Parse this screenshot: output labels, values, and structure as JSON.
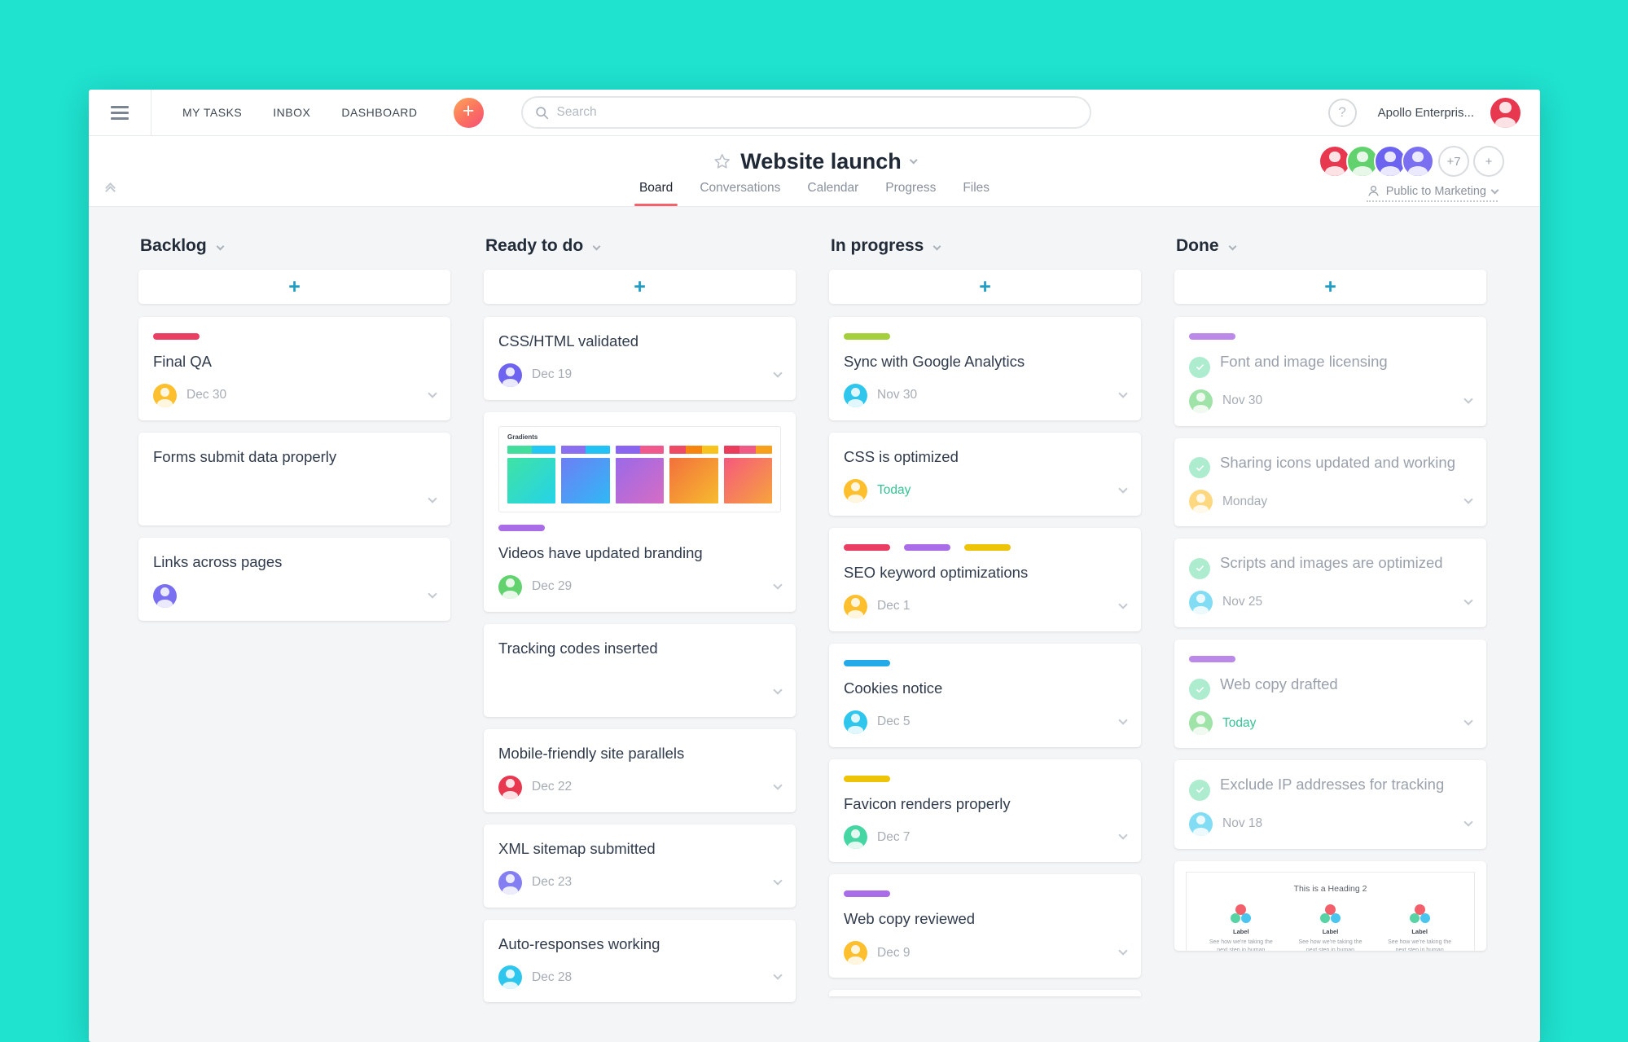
{
  "colors": {
    "page_bg": "#1fe2cf",
    "tab_underline_red": "#f5626a",
    "add_card_teal": "#1f9dc6",
    "today_green": "#36c493",
    "done_check_mint": "#aeeccf"
  },
  "nav": {
    "items": [
      "MY TASKS",
      "INBOX",
      "DASHBOARD"
    ],
    "add_button": "+",
    "search_placeholder": "Search",
    "help_label": "?",
    "workspace": "Apollo Enterpris...",
    "profile_avatar_color": "#e8384f"
  },
  "header": {
    "title": "Website launch",
    "tabs": [
      {
        "label": "Board",
        "active": true
      },
      {
        "label": "Conversations",
        "active": false
      },
      {
        "label": "Calendar",
        "active": false
      },
      {
        "label": "Progress",
        "active": false
      },
      {
        "label": "Files",
        "active": false
      }
    ],
    "member_avatars": [
      "#e8384f",
      "#62d26f",
      "#6c63f0",
      "#7a6ff0"
    ],
    "members_overflow": "+7",
    "add_member": "+",
    "privacy": "Public to Marketing"
  },
  "board": {
    "add_card_label": "+",
    "columns": [
      {
        "title": "Backlog",
        "cards": [
          {
            "title": "Final QA",
            "tags": [
              "#ea3e63"
            ],
            "avatar": "#fdbf2d",
            "due": "Dec 30"
          },
          {
            "title": "Forms submit data properly"
          },
          {
            "title": "Links across pages",
            "avatar": "#7a6ff0"
          }
        ]
      },
      {
        "title": "Ready to do",
        "cards": [
          {
            "title": "CSS/HTML validated",
            "avatar": "#6e63f0",
            "due": "Dec 19"
          },
          {
            "title": "Videos have updated branding",
            "tags": [
              "#aa6de8"
            ],
            "avatar": "#62d26f",
            "due": "Dec 29",
            "attachment": "gradients"
          },
          {
            "title": "Tracking codes inserted"
          },
          {
            "title": "Mobile-friendly site parallels",
            "avatar": "#e8384f",
            "due": "Dec 22"
          },
          {
            "title": "XML sitemap submitted",
            "avatar": "#837ff2",
            "due": "Dec 23"
          },
          {
            "title": "Auto-responses working",
            "avatar": "#2fc6ee",
            "due": "Dec 28"
          }
        ]
      },
      {
        "title": "In progress",
        "cards": [
          {
            "title": "Sync with Google Analytics",
            "tags": [
              "#a5cf3c"
            ],
            "avatar": "#2fc6ee",
            "due": "Nov 30"
          },
          {
            "title": "CSS is optimized",
            "avatar": "#fdbf2d",
            "due": "Today",
            "due_today": true
          },
          {
            "title": "SEO keyword optimizations",
            "tags": [
              "#ea3e63",
              "#aa6de8",
              "#edc407"
            ],
            "avatar": "#fdbf2d",
            "due": "Dec 1"
          },
          {
            "title": "Cookies notice",
            "tags": [
              "#25a9e8"
            ],
            "avatar": "#2fc6ee",
            "due": "Dec 5"
          },
          {
            "title": "Favicon renders properly",
            "tags": [
              "#edc407"
            ],
            "avatar": "#45d6a3",
            "due": "Dec 7"
          },
          {
            "title": "Web copy reviewed",
            "tags": [
              "#aa6de8"
            ],
            "avatar": "#fdbf2d",
            "due": "Dec 9"
          },
          {
            "sliver": true
          }
        ]
      },
      {
        "title": "Done",
        "cards": [
          {
            "title": "Font and image licensing",
            "tags": [
              "#bb8ae8"
            ],
            "avatar": "#62d26f",
            "due": "Nov 30",
            "done": true
          },
          {
            "title": "Sharing icons updated and working",
            "avatar": "#fdbf2d",
            "due": "Monday",
            "done": true
          },
          {
            "title": "Scripts and images are optimized",
            "avatar": "#2fc6ee",
            "due": "Nov 25",
            "done": true
          },
          {
            "title": "Web copy drafted",
            "tags": [
              "#bb8ae8"
            ],
            "avatar": "#62d26f",
            "due": "Today",
            "due_today": true,
            "done": true
          },
          {
            "title": "Exclude IP addresses for tracking",
            "avatar": "#2fc6ee",
            "due": "Nov 18",
            "done": true
          },
          {
            "attachment": "webpage"
          }
        ]
      }
    ]
  },
  "attachments": {
    "gradients": {
      "label": "Gradients",
      "swatches": [
        {
          "top": [
            "#43dd9d",
            "#23c9f2"
          ],
          "body": [
            "#3fe3a4",
            "#25d3e8"
          ]
        },
        {
          "top": [
            "#8a6ff0",
            "#23c1f5"
          ],
          "body": [
            "#6d7ef5",
            "#2fb9f5"
          ]
        },
        {
          "top": [
            "#8a66f0",
            "#f0598e"
          ],
          "body": [
            "#9a6ae8",
            "#d66cc4"
          ]
        },
        {
          "top": [
            "#ed4a66",
            "#f5850f",
            "#f7c31e"
          ],
          "body": [
            "#f2703d",
            "#f7bb2e"
          ]
        },
        {
          "top": [
            "#ea3c5c",
            "#f05b86",
            "#f7a01e"
          ],
          "body": [
            "#f5597d",
            "#f7a43c"
          ]
        }
      ]
    },
    "webpage": {
      "heading": "This is a Heading 2",
      "label": "Label",
      "blurb": "See how we're taking the next step in human productivity",
      "columns": 3
    }
  }
}
